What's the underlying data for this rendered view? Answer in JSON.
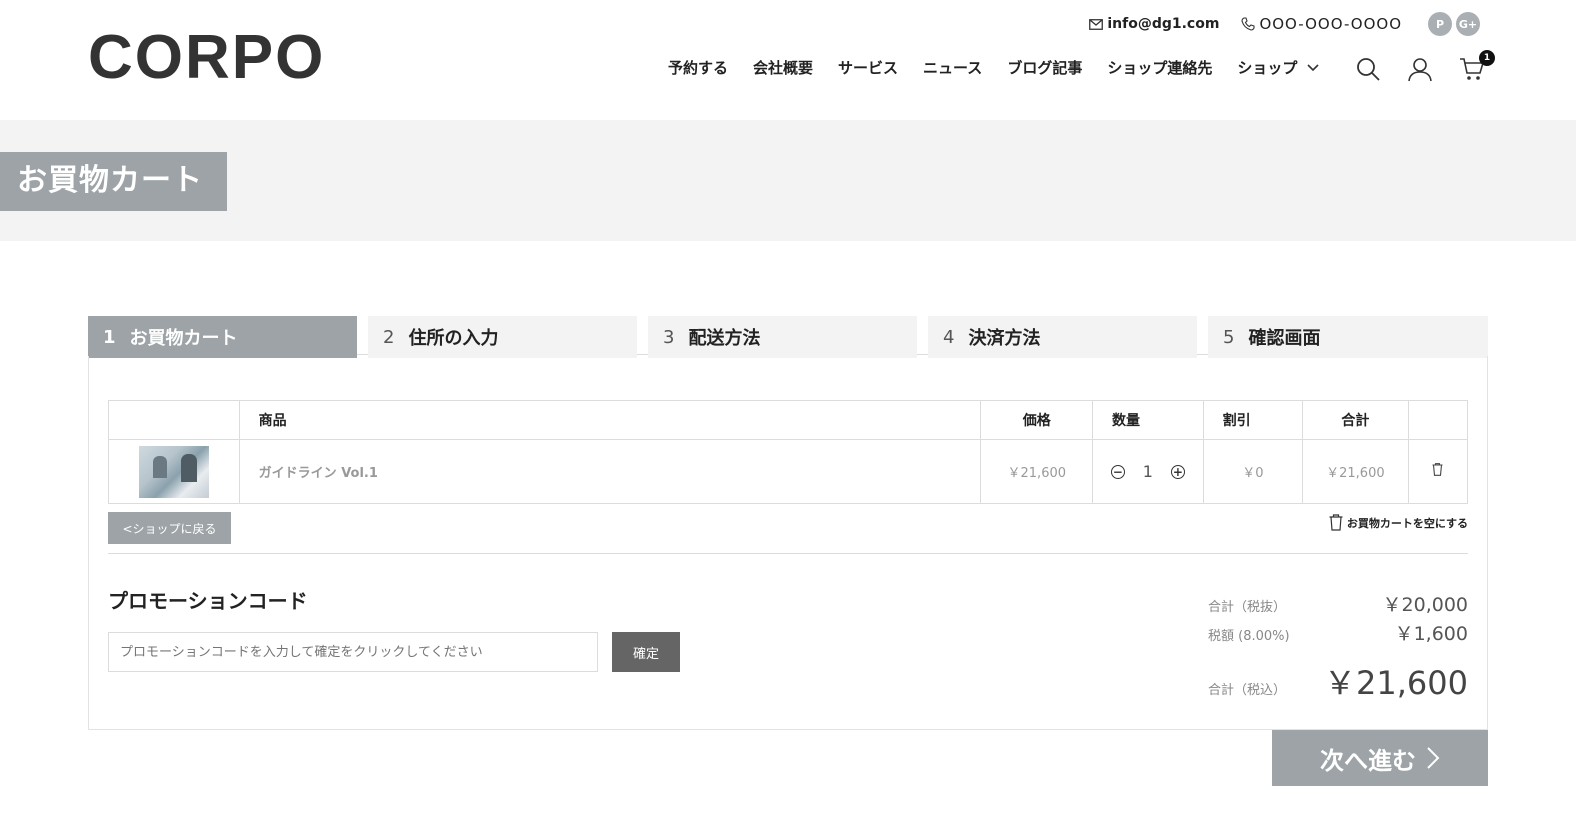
{
  "header": {
    "logo": "CORPO",
    "email": "info@dg1.com",
    "phone": "OOO-OOO-OOOO",
    "social": [
      "P",
      "G+"
    ],
    "nav": [
      "予約する",
      "会社概要",
      "サービス",
      "ニュース",
      "ブログ記事",
      "ショップ連絡先",
      "ショップ"
    ],
    "cart_count": "1"
  },
  "page": {
    "title": "お買物カート"
  },
  "steps": [
    {
      "num": "1",
      "label": "お買物カート",
      "active": true
    },
    {
      "num": "2",
      "label": "住所の入力"
    },
    {
      "num": "3",
      "label": "配送方法"
    },
    {
      "num": "4",
      "label": "決済方法"
    },
    {
      "num": "5",
      "label": "確認画面"
    }
  ],
  "cart": {
    "headers": [
      "",
      "商品",
      "価格",
      "数量",
      "割引",
      "合計",
      ""
    ],
    "items": [
      {
        "name": "ガイドライン Vol.1",
        "price": "￥21,600",
        "qty": "1",
        "discount": "￥0",
        "total": "￥21,600"
      }
    ],
    "back_label": "<ショップに戻る",
    "empty_label": "お買物カートを空にする"
  },
  "promo": {
    "title": "プロモーションコード",
    "placeholder": "プロモーションコードを入力して確定をクリックしてください",
    "button": "確定"
  },
  "totals": {
    "subtotal_label": "合計（税抜）",
    "subtotal": "￥20,000",
    "tax_label": "税額 (8.00%)",
    "tax": "￥1,600",
    "grand_label": "合計（税込）",
    "grand": "￥21,600"
  },
  "next_label": "次へ進む"
}
